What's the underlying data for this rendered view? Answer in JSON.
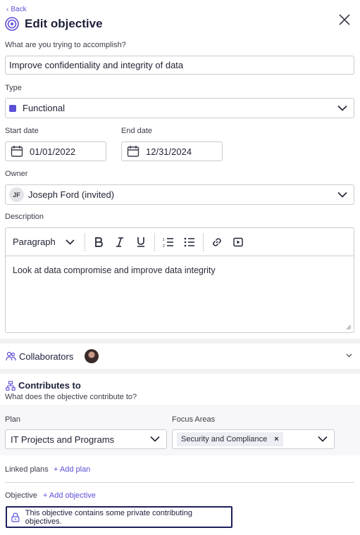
{
  "header": {
    "back_label": "Back",
    "title": "Edit objective"
  },
  "objective": {
    "label": "What are you trying to accomplish?",
    "value": "Improve confidentiality and integrity of data"
  },
  "type": {
    "label": "Type",
    "value": "Functional",
    "swatch_color": "#5b4fd6"
  },
  "start_date": {
    "label": "Start date",
    "value": "01/01/2022"
  },
  "end_date": {
    "label": "End date",
    "value": "12/31/2024"
  },
  "owner": {
    "label": "Owner",
    "initials": "JF",
    "value": "Joseph Ford (invited)"
  },
  "description": {
    "label": "Description",
    "block_style": "Paragraph",
    "text": "Look at data compromise and improve data integrity",
    "toolbar_icons": [
      "bold-icon",
      "italic-icon",
      "underline-icon",
      "ordered-list-icon",
      "bullet-list-icon",
      "link-icon",
      "video-icon"
    ]
  },
  "collaborators": {
    "title": "Collaborators"
  },
  "contributes": {
    "title": "Contributes to",
    "subtitle": "What does the objective contribute to?",
    "plan_label": "Plan",
    "plan_value": "IT Projects and Programs",
    "focus_label": "Focus Areas",
    "focus_tag": "Security and Compliance",
    "linked_plans_label": "Linked plans",
    "add_plan": "+ Add plan",
    "objective_label": "Objective",
    "add_objective": "+ Add objective",
    "private_notice": "This objective contains some private contributing objectives."
  },
  "colors": {
    "accent": "#5b4fd6",
    "border": "#c9cbd3",
    "notice_border": "#1d1f5c"
  }
}
